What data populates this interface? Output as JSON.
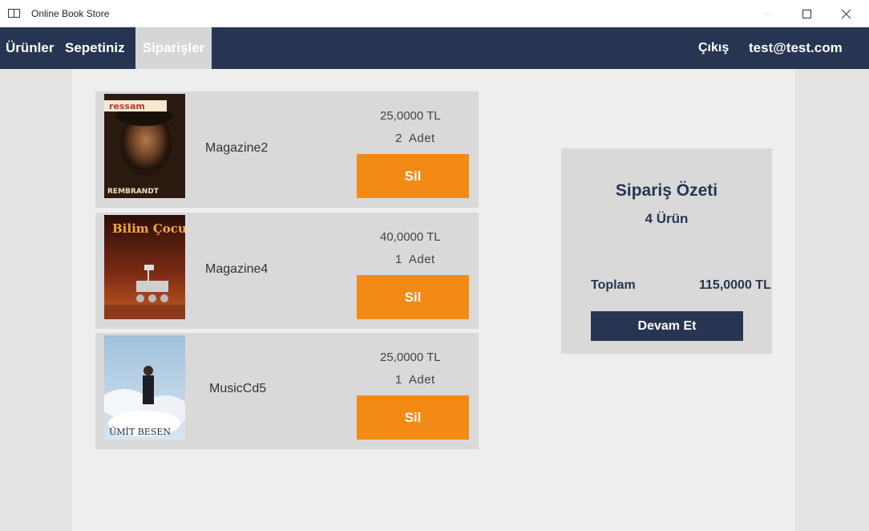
{
  "window": {
    "title": "Online Book Store"
  },
  "nav": {
    "urunler": "Ürünler",
    "sepetiniz": "Sepetiniz",
    "siparisler": "Siparişler",
    "cikis": "Çıkış",
    "user": "test@test.com"
  },
  "orders": [
    {
      "name": "Magazine2",
      "price": "25,0000 TL",
      "qty": "2",
      "unit": "Adet",
      "remove_label": "Sil",
      "cover": {
        "top_text": "ressam",
        "bottom_text": "REMBRANDT",
        "image": "rembrandt-portrait"
      }
    },
    {
      "name": "Magazine4",
      "price": "40,0000 TL",
      "qty": "1",
      "unit": "Adet",
      "remove_label": "Sil",
      "cover": {
        "top_text": "Bilim Çocuk",
        "image": "mars-rover"
      }
    },
    {
      "name": "MusicCd5",
      "price": "25,0000 TL",
      "qty": "1",
      "unit": "Adet",
      "remove_label": "Sil",
      "cover": {
        "bottom_text": "ÜMİT BESEN",
        "image": "man-in-clouds"
      }
    }
  ],
  "summary": {
    "title": "Sipariş Özeti",
    "count": "4 Ürün",
    "total_label": "Toplam",
    "total_value": "115,0000 TL",
    "continue_label": "Devam Et"
  },
  "colors": {
    "navbar": "#273552",
    "accent": "#f38a13",
    "active_tab": "#d5d6d8",
    "card": "#d9d9d9"
  }
}
